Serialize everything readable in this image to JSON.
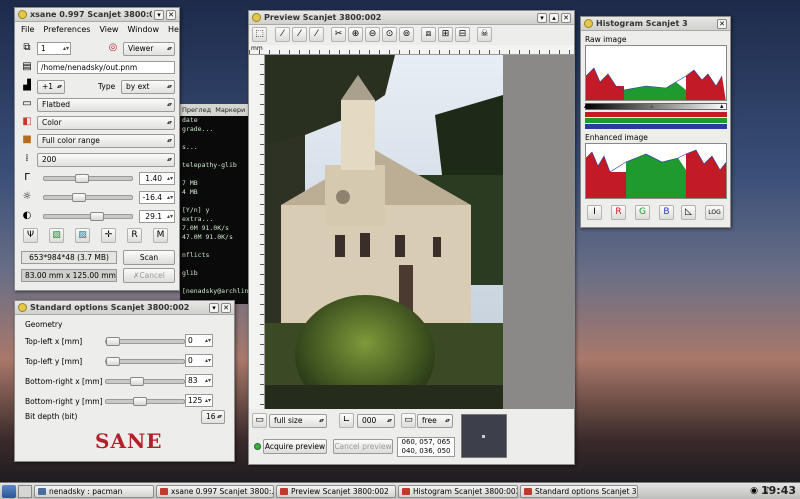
{
  "colors": {
    "terminal_text": "#cbe8cb",
    "sane_logo": "#b3202a",
    "hist_green": "#1e9a2e",
    "hist_red": "#c21b26",
    "hist_blue": "#283ca8"
  },
  "terminal": {
    "menu": [
      "Преглед",
      "Маркери"
    ],
    "lines": [
      "date",
      "grade...",
      "",
      "s...",
      "",
      "telepathy-glib",
      "",
      "7 MB",
      "4 MB",
      "",
      "[Y/n] y",
      "extra...",
      "7.0M  91.0K/s",
      "47.0M  91.0K/s",
      "",
      "nflicts",
      "",
      "glib",
      "",
      "[nenadsky@archlinux ~]$"
    ]
  },
  "xsane": {
    "title": "xsane 0.997 Scanjet 3800:002",
    "menu": [
      "File",
      "Preferences",
      "View",
      "Window",
      "Help"
    ],
    "copies": "1",
    "mode": "Viewer",
    "filename": "/home/nenadsky/out.pnm",
    "step": "+1",
    "type_label": "Type",
    "type_value": "by ext",
    "source": "Flatbed",
    "color_mode": "Color",
    "color_range": "Full color range",
    "resolution": "200",
    "gamma": "1.40",
    "brightness": "-16.4",
    "contrast": "29.1",
    "gamma_level": 0.42,
    "brightness_level": 0.38,
    "contrast_level": 0.62,
    "image_info": "653*984*48 (3.7 MB)",
    "scan_label": "Scan",
    "size_info": "83.00 mm x 125.00 mm",
    "cancel_label": "Cancel"
  },
  "std_options": {
    "title": "Standard options Scanjet 3800:002",
    "section": "Geometry",
    "fields": [
      {
        "label": "Top-left x [mm]",
        "value": "0",
        "level": 0.0
      },
      {
        "label": "Top-left y [mm]",
        "value": "0",
        "level": 0.0
      },
      {
        "label": "Bottom-right x [mm]",
        "value": "83",
        "level": 0.38
      },
      {
        "label": "Bottom-right y [mm]",
        "value": "125",
        "level": 0.42
      }
    ],
    "bit_depth_label": "Bit depth (bit)",
    "bit_depth": "16",
    "logo": "SANE"
  },
  "preview": {
    "title": "Preview Scanjet 3800:002",
    "ruler_unit": "mm",
    "zoom": "full size",
    "rotation": "000",
    "aspect": "free",
    "acquire_label": "Acquire preview",
    "cancel_label": "Cancel preview",
    "pixel_rgb": "060, 057, 065",
    "pixel_rgb2": "040, 036, 050"
  },
  "histogram": {
    "title": "Histogram Scanjet 3",
    "raw_label": "Raw image",
    "enhanced_label": "Enhanced image",
    "log_label": "LOG"
  },
  "taskbar": {
    "tasks": [
      "nenadsky : pacman",
      "xsane 0.997 Scanjet 3800:...",
      "Preview Scanjet 3800:002",
      "Histogram Scanjet 3800:002",
      "Standard options Scanjet 3..."
    ],
    "clock": "19:43"
  }
}
